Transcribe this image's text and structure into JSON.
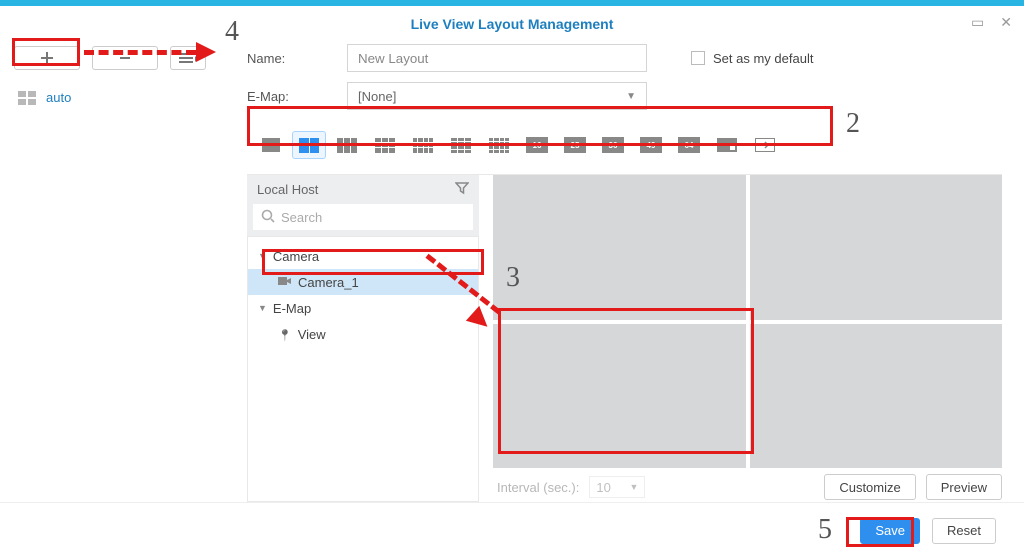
{
  "window": {
    "title": "Live View Layout Management"
  },
  "sidebar": {
    "auto_label": "auto"
  },
  "form": {
    "name_label": "Name:",
    "name_value": "New Layout",
    "emap_label": "E-Map:",
    "emap_value": "[None]",
    "default_label": "Set as my default"
  },
  "layout_nums": {
    "n16": "16",
    "n25": "25",
    "n36": "36",
    "n49": "49",
    "n64": "64"
  },
  "tree": {
    "host_label": "Local Host",
    "search_placeholder": "Search",
    "camera_group": "Camera",
    "camera_item": "Camera_1",
    "emap_group": "E-Map",
    "view_item": "View"
  },
  "preview": {
    "interval_label": "Interval (sec.):",
    "interval_value": "10",
    "customize": "Customize",
    "preview": "Preview"
  },
  "footer": {
    "save": "Save",
    "reset": "Reset"
  },
  "annotations": {
    "n2": "2",
    "n3": "3",
    "n4": "4",
    "n5": "5"
  }
}
